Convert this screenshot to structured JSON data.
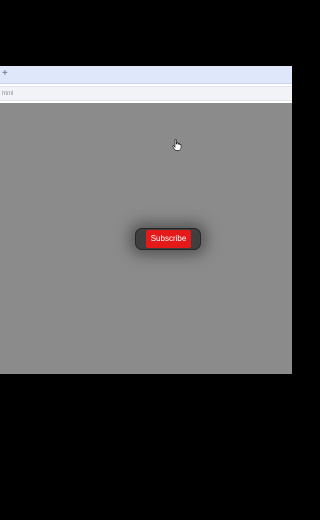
{
  "browser": {
    "new_tab_symbol": "+",
    "url_text": "html"
  },
  "page": {
    "background": "#8b8b8b",
    "subscribe_label": "Subscribe",
    "subscribe_color": "#e41a1a",
    "pill_color": "#3f3f3f"
  },
  "pointer": {
    "icon": "hand-pointer-icon"
  }
}
